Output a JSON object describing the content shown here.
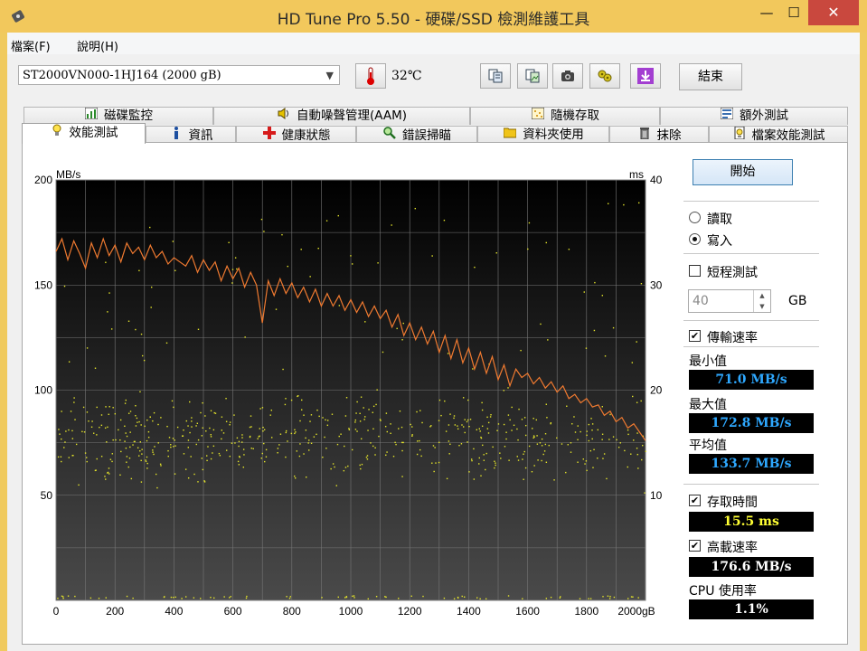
{
  "window": {
    "title": "HD Tune Pro 5.50 - 硬碟/SSD 檢測維護工具",
    "min_icon": "minimize-icon",
    "max_icon": "maximize-icon",
    "close_icon": "close-icon"
  },
  "menubar": {
    "file": "檔案(F)",
    "help": "說明(H)"
  },
  "toolbar": {
    "drive": "ST2000VN000-1HJ164 (2000 gB)",
    "temperature": "32℃",
    "exit_label": "結束"
  },
  "tabs_row1": [
    {
      "label": "磁碟監控",
      "icon": "disk-monitor-icon"
    },
    {
      "label": "自動噪聲管理(AAM)",
      "icon": "speaker-icon"
    },
    {
      "label": "隨機存取",
      "icon": "random-access-icon"
    },
    {
      "label": "額外測試",
      "icon": "extra-tests-icon"
    }
  ],
  "tabs_row2": [
    {
      "label": "效能測試",
      "icon": "benchmark-icon"
    },
    {
      "label": "資訊",
      "icon": "info-icon"
    },
    {
      "label": "健康狀態",
      "icon": "health-icon"
    },
    {
      "label": "錯誤掃瞄",
      "icon": "error-scan-icon"
    },
    {
      "label": "資料夾使用",
      "icon": "folder-icon"
    },
    {
      "label": "抹除",
      "icon": "erase-icon"
    },
    {
      "label": "檔案效能測試",
      "icon": "file-benchmark-icon"
    }
  ],
  "controls": {
    "start_label": "開始",
    "read_label": "讀取",
    "write_label": "寫入",
    "mode_selected": "write",
    "short_test_label": "短程測試",
    "short_test_checked": false,
    "size_value": "40",
    "size_unit": "GB",
    "transfer_rate_label": "傳輸速率",
    "transfer_rate_checked": true,
    "min_label": "最小值",
    "min_value": "71.0 MB/s",
    "max_label": "最大值",
    "max_value": "172.8 MB/s",
    "avg_label": "平均值",
    "avg_value": "133.7 MB/s",
    "access_time_label": "存取時間",
    "access_time_checked": true,
    "access_time_value": "15.5 ms",
    "burst_rate_label": "高載速率",
    "burst_rate_checked": true,
    "burst_rate_value": "176.6 MB/s",
    "cpu_label": "CPU 使用率",
    "cpu_value": "1.1%"
  },
  "colors": {
    "value_text": "#2ea8ff",
    "access_text": "#ffff33",
    "plain_text": "#ffffff",
    "transfer_line": "#f07a30",
    "access_dots": "#e6e62a"
  },
  "chart_data": {
    "type": "line",
    "xlabel": "gB",
    "ylabel_left": "MB/s",
    "ylabel_right": "ms",
    "xlim": [
      0,
      2000
    ],
    "ylim_left": [
      0,
      200
    ],
    "ylim_right": [
      0,
      40
    ],
    "x_ticks": [
      "0",
      "200",
      "400",
      "600",
      "800",
      "1000",
      "1200",
      "1400",
      "1600",
      "1800",
      "2000gB"
    ],
    "y_left_ticks": [
      "50",
      "100",
      "150",
      "200"
    ],
    "y_right_ticks": [
      "10",
      "20",
      "30",
      "40"
    ],
    "grid": true,
    "series": [
      {
        "kind": "transfer",
        "x": [
          0,
          20,
          40,
          60,
          80,
          100,
          120,
          140,
          160,
          180,
          200,
          220,
          240,
          260,
          280,
          300,
          320,
          340,
          360,
          380,
          400,
          420,
          440,
          460,
          480,
          500,
          520,
          540,
          560,
          580,
          600,
          620,
          640,
          660,
          680,
          700,
          720,
          740,
          760,
          780,
          800,
          820,
          840,
          860,
          880,
          900,
          920,
          940,
          960,
          980,
          1000,
          1020,
          1040,
          1060,
          1080,
          1100,
          1120,
          1140,
          1160,
          1180,
          1200,
          1220,
          1240,
          1260,
          1280,
          1300,
          1320,
          1340,
          1360,
          1380,
          1400,
          1420,
          1440,
          1460,
          1480,
          1500,
          1520,
          1540,
          1560,
          1580,
          1600,
          1620,
          1640,
          1660,
          1680,
          1700,
          1720,
          1740,
          1760,
          1780,
          1800,
          1820,
          1840,
          1860,
          1880,
          1900,
          1920,
          1940,
          1960,
          1980,
          2000
        ],
        "y": [
          166,
          172,
          162,
          171,
          165,
          158,
          170,
          163,
          172,
          164,
          169,
          161,
          170,
          165,
          168,
          162,
          169,
          163,
          166,
          160,
          163,
          161,
          159,
          164,
          156,
          162,
          157,
          161,
          152,
          159,
          153,
          158,
          149,
          156,
          150,
          132,
          152,
          145,
          153,
          146,
          151,
          144,
          149,
          142,
          148,
          140,
          146,
          140,
          145,
          138,
          143,
          137,
          142,
          135,
          140,
          134,
          138,
          130,
          136,
          126,
          132,
          124,
          130,
          122,
          128,
          118,
          126,
          115,
          124,
          113,
          120,
          110,
          118,
          108,
          116,
          105,
          112,
          102,
          110,
          106,
          108,
          103,
          106,
          101,
          104,
          99,
          102,
          96,
          98,
          94,
          96,
          92,
          93,
          88,
          90,
          85,
          87,
          82,
          84,
          80,
          76
        ]
      },
      {
        "kind": "access_time",
        "unit": "ms",
        "typical": 15.5
      }
    ]
  }
}
